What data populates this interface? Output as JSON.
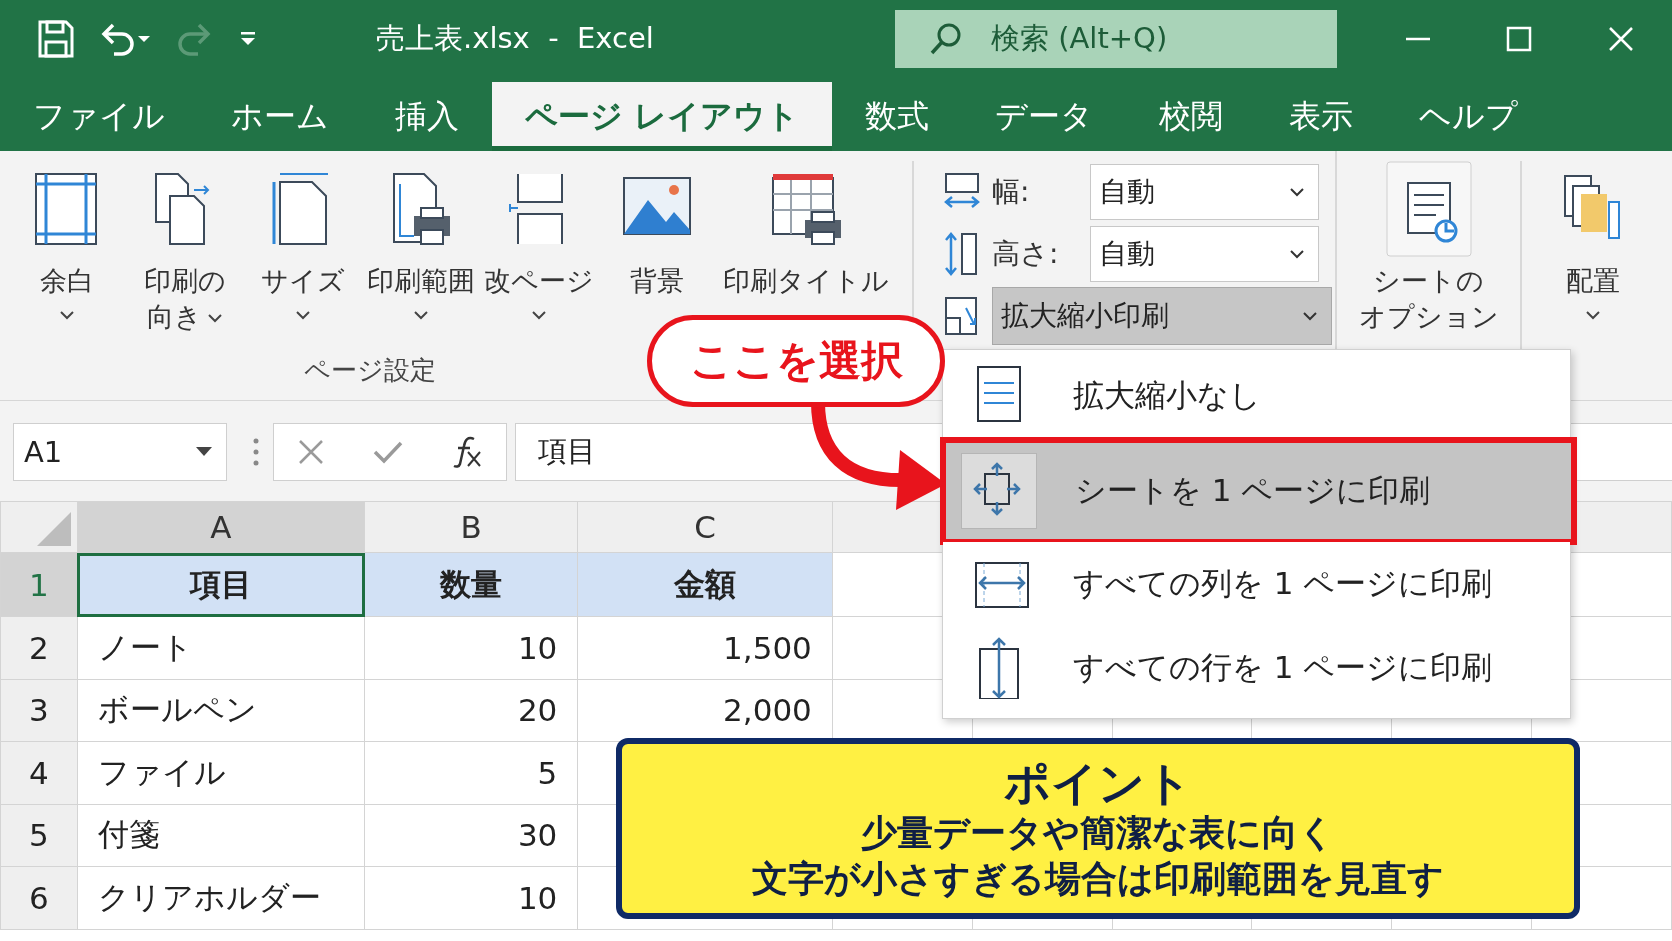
{
  "title_bar": {
    "quick_access": [
      {
        "kind": "save",
        "disabled": false
      },
      {
        "kind": "undo",
        "disabled": false
      },
      {
        "kind": "redo",
        "disabled": true
      },
      {
        "kind": "customize",
        "disabled": false
      }
    ],
    "title": "売上表.xlsx  -  Excel",
    "search": {
      "placeholder": "検索 (Alt+Q)"
    }
  },
  "tabs": [
    {
      "label": "ファイル",
      "selected": false
    },
    {
      "label": "ホーム",
      "selected": false
    },
    {
      "label": "挿入",
      "selected": false
    },
    {
      "label": "ページ レイアウト",
      "selected": true
    },
    {
      "label": "数式",
      "selected": false
    },
    {
      "label": "データ",
      "selected": false
    },
    {
      "label": "校閲",
      "selected": false
    },
    {
      "label": "表示",
      "selected": false
    },
    {
      "label": "ヘルプ",
      "selected": false
    }
  ],
  "ribbon": {
    "page_setup": {
      "label": "ページ設定",
      "buttons": [
        {
          "label": "余白",
          "has_menu": true
        },
        {
          "label": "印刷の向き",
          "has_menu": true
        },
        {
          "label": "サイズ",
          "has_menu": true
        },
        {
          "label": "印刷範囲",
          "has_menu": true
        },
        {
          "label": "改ページ",
          "has_menu": true
        },
        {
          "label": "背景",
          "has_menu": false
        },
        {
          "label": "印刷タイトル",
          "has_menu": false
        }
      ]
    },
    "scale": {
      "fields": [
        {
          "label": "幅:",
          "value": "自動"
        },
        {
          "label": "高さ:",
          "value": "自動"
        }
      ],
      "scale_dropdown": {
        "label": "拡大縮小印刷",
        "expanded": true
      }
    },
    "sheet_options": {
      "lines": [
        "シートの",
        "オプション"
      ],
      "has_menu": false
    },
    "arrange": {
      "label": "配置",
      "has_menu": true
    }
  },
  "formula_bar": {
    "name_box": "A1",
    "formula": "項目"
  },
  "sheet": {
    "columns": [
      {
        "label": "A",
        "selected": true
      },
      {
        "label": "B",
        "selected": false
      },
      {
        "label": "C",
        "selected": false
      }
    ],
    "rows": [
      {
        "number": "1",
        "kind": "header",
        "selected": true,
        "cells": [
          "項目",
          "数量",
          "金額"
        ]
      },
      {
        "number": "2",
        "kind": "data",
        "selected": false,
        "cells": [
          "ノート",
          "10",
          "1,500"
        ]
      },
      {
        "number": "3",
        "kind": "data",
        "selected": false,
        "cells": [
          "ボールペン",
          "20",
          "2,000"
        ]
      },
      {
        "number": "4",
        "kind": "data",
        "selected": false,
        "cells": [
          "ファイル",
          "5"
        ]
      },
      {
        "number": "5",
        "kind": "data",
        "selected": false,
        "cells": [
          "付箋",
          "30"
        ]
      },
      {
        "number": "6",
        "kind": "data",
        "selected": false,
        "cells": [
          "クリアホルダー",
          "10"
        ]
      }
    ]
  },
  "scale_menu": {
    "items": [
      {
        "label": "拡大縮小なし",
        "selected": false
      },
      {
        "label": "シートを 1 ページに印刷",
        "selected": true
      },
      {
        "label": "すべての列を 1 ページに印刷",
        "selected": false
      },
      {
        "label": "すべての行を 1 ページに印刷",
        "selected": false
      }
    ]
  },
  "annotation": {
    "callout": "ここを選択",
    "note": {
      "title": "ポイント",
      "lines": [
        "少量データや簡潔な表に向く",
        "文字が小さすぎる場合は印刷範囲を見直す"
      ]
    }
  }
}
